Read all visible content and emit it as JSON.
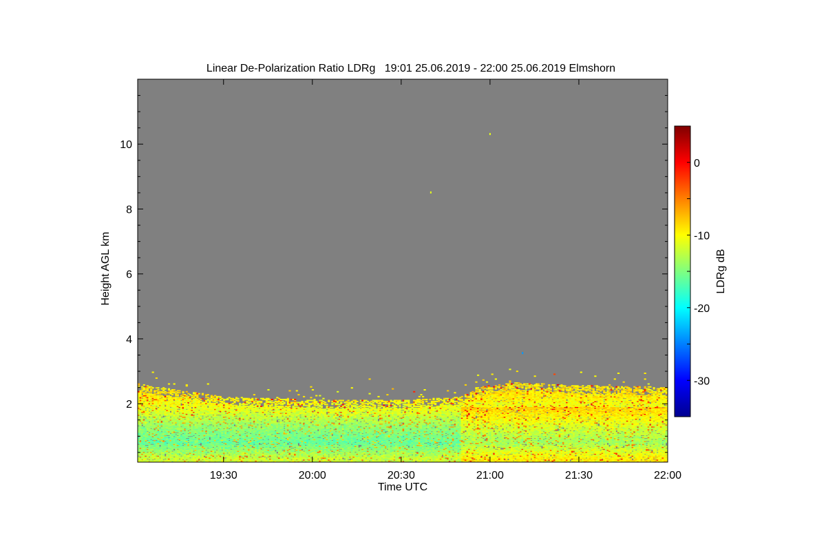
{
  "chart_data": {
    "type": "heatmap",
    "title": "Linear De-Polarization Ratio LDRg   19:01 25.06.2019 - 22:00 25.06.2019 Elmshorn",
    "xlabel": "Time UTC",
    "ylabel": "Height AGL km",
    "colorbar_label": "LDRg dB",
    "x_range_minutes_utc": [
      1141,
      1320
    ],
    "x_ticks": [
      {
        "label": "19:30",
        "minutes": 1170
      },
      {
        "label": "20:00",
        "minutes": 1200
      },
      {
        "label": "20:30",
        "minutes": 1230
      },
      {
        "label": "21:00",
        "minutes": 1260
      },
      {
        "label": "21:30",
        "minutes": 1290
      },
      {
        "label": "22:00",
        "minutes": 1320
      }
    ],
    "y_range_km": [
      0.2,
      12.0
    ],
    "y_ticks": [
      {
        "label": "2",
        "value": 2
      },
      {
        "label": "4",
        "value": 4
      },
      {
        "label": "6",
        "value": 6
      },
      {
        "label": "8",
        "value": 8
      },
      {
        "label": "10",
        "value": 10
      }
    ],
    "colorbar_range_db": [
      -35,
      5
    ],
    "colorbar_ticks": [
      {
        "label": "0",
        "value": 0
      },
      {
        "label": "-10",
        "value": -10
      },
      {
        "label": "-20",
        "value": -20
      },
      {
        "label": "-30",
        "value": -30
      }
    ],
    "colormap": "jet",
    "no_data_color": "#808080",
    "layer_top_km": [
      {
        "minutes": 1141,
        "height_km": 2.6
      },
      {
        "minutes": 1170,
        "height_km": 2.2
      },
      {
        "minutes": 1200,
        "height_km": 2.1
      },
      {
        "minutes": 1230,
        "height_km": 2.1
      },
      {
        "minutes": 1250,
        "height_km": 2.2
      },
      {
        "minutes": 1255,
        "height_km": 2.5
      },
      {
        "minutes": 1270,
        "height_km": 2.65
      },
      {
        "minutes": 1290,
        "height_km": 2.55
      },
      {
        "minutes": 1320,
        "height_km": 2.5
      }
    ],
    "typical_ldr_db_by_height": [
      {
        "height_km": 0.3,
        "ldr_db": -12
      },
      {
        "height_km": 0.8,
        "ldr_db": -16
      },
      {
        "height_km": 1.3,
        "ldr_db": -14
      },
      {
        "height_km": 1.8,
        "ldr_db": -11
      },
      {
        "height_km": 2.3,
        "ldr_db": -9
      }
    ],
    "isolated_echoes": [
      {
        "minutes": 1240,
        "height_km": 8.5,
        "ldr_db": -11
      },
      {
        "minutes": 1260,
        "height_km": 10.3,
        "ldr_db": -11
      },
      {
        "minutes": 1271,
        "height_km": 3.55,
        "ldr_db": -24
      }
    ],
    "grid": false,
    "legend": "colorbar-right"
  }
}
